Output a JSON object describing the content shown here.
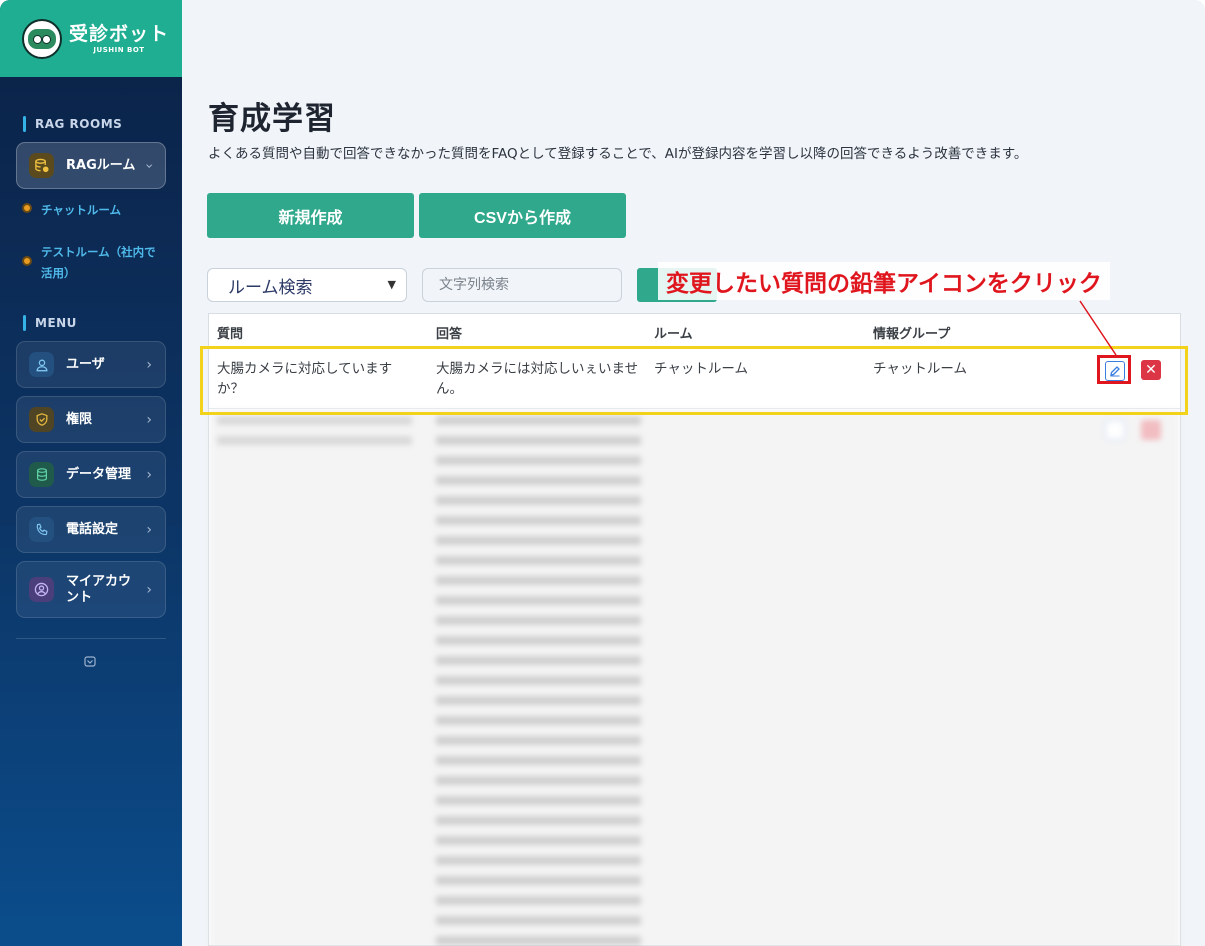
{
  "app": {
    "name": "受診ボット",
    "sub": "JUSHIN BOT"
  },
  "sidebar": {
    "rag_label": "RAG ROOMS",
    "rag_button": "RAGルーム",
    "rooms": [
      "チャットルーム",
      "テストルーム（社内で活用）"
    ],
    "menu_label": "MENU",
    "menu": [
      {
        "label": "ユーザ",
        "icon": "user-icon"
      },
      {
        "label": "権限",
        "icon": "shield-icon"
      },
      {
        "label": "データ管理",
        "icon": "database-icon"
      },
      {
        "label": "電話設定",
        "icon": "phone-icon"
      },
      {
        "label": "マイアカウント",
        "icon": "account-icon"
      }
    ]
  },
  "page": {
    "title": "育成学習",
    "description": "よくある質問や自動で回答できなかった質問をFAQとして登録することで、AIが登録内容を学習し以降の回答できるよう改善できます。"
  },
  "actions": {
    "new": "新規作成",
    "csv": "CSVから作成"
  },
  "filters": {
    "room_select": "ルーム検索",
    "text_placeholder": "文字列検索"
  },
  "table": {
    "headers": [
      "質問",
      "回答",
      "ルーム",
      "情報グループ"
    ],
    "rows": [
      {
        "question": "大腸カメラに対応していますか？",
        "answer": "大腸カメラには対応しいぇいません。",
        "room": "チャットルーム",
        "group": "チャットルーム"
      }
    ]
  },
  "annotation": {
    "callout": "変更したい質問の鉛筆アイコンをクリック"
  },
  "colors": {
    "brand": "#1fae91",
    "accent_green": "#2fa88c",
    "highlight": "#f2d21b",
    "annotation_red": "#e0161e"
  }
}
